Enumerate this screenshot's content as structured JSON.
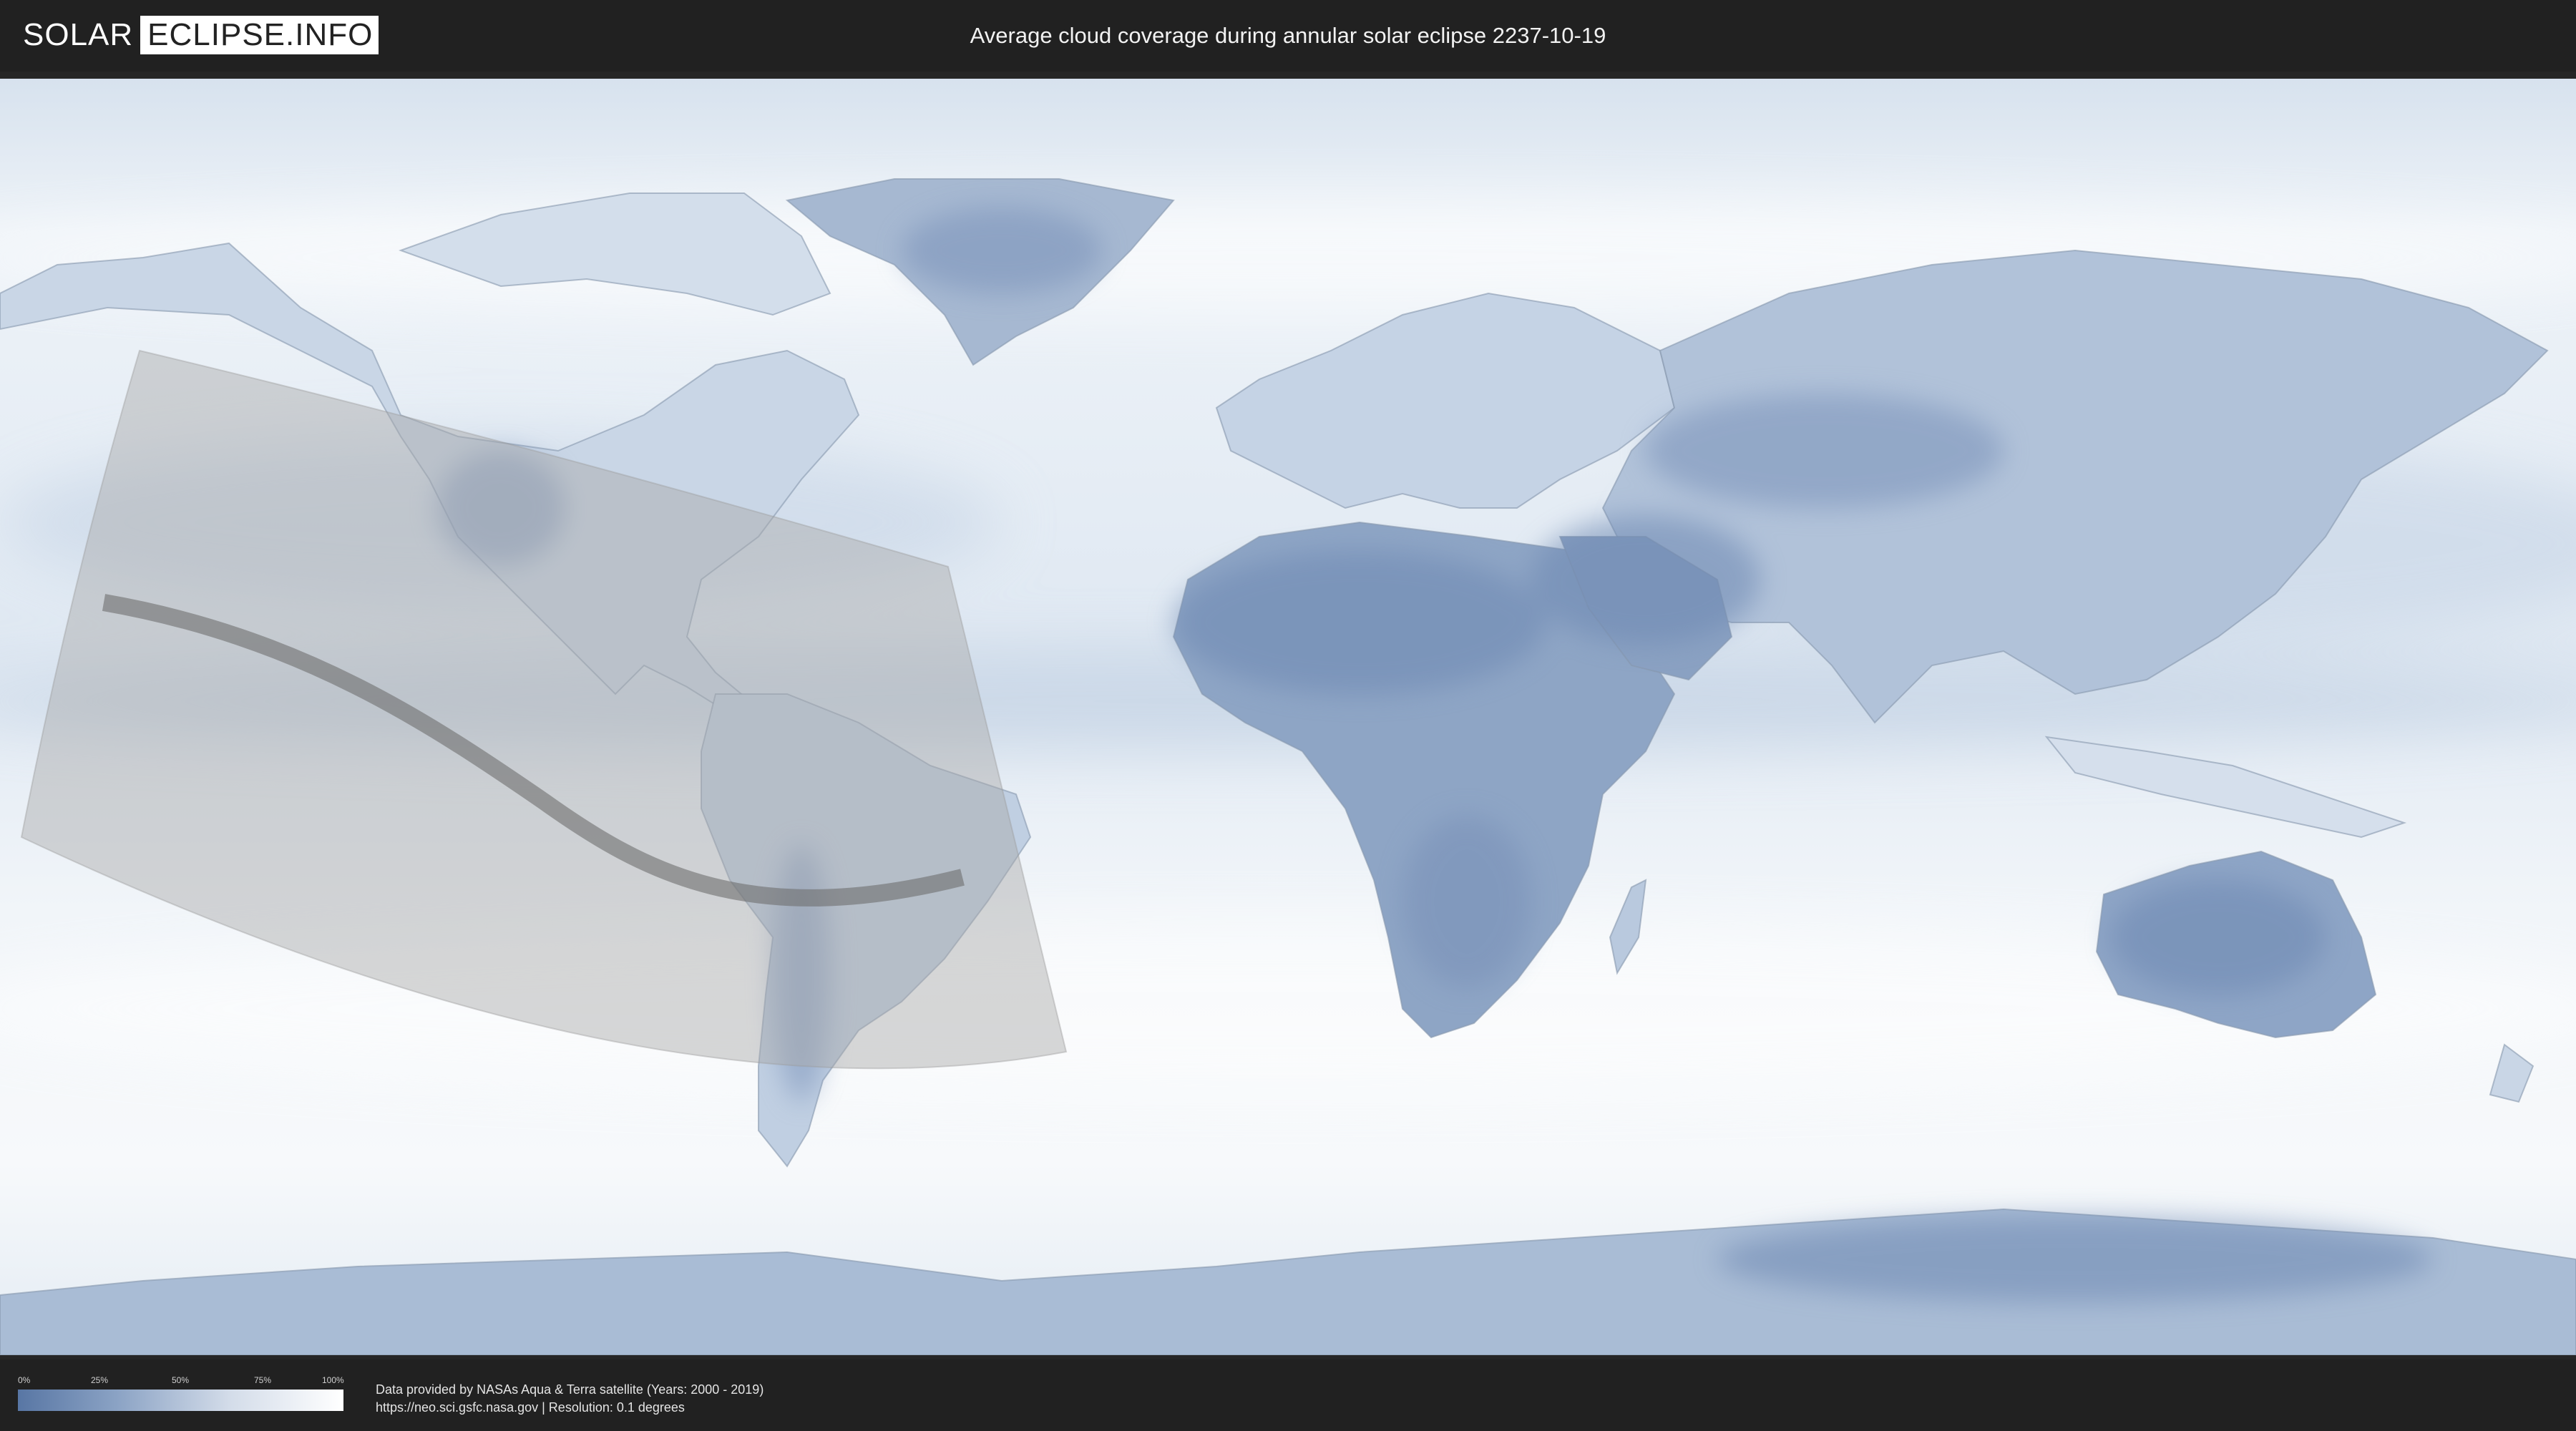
{
  "header": {
    "logo_part1": "SOLAR",
    "logo_part2": "ECLIPSE.INFO",
    "title": "Average cloud coverage during annular solar eclipse 2237-10-19"
  },
  "legend": {
    "ticks": [
      "0%",
      "25%",
      "50%",
      "75%",
      "100%"
    ],
    "colors": {
      "low": "#5876a4",
      "mid": "#b7c7dd",
      "high": "#ffffff"
    }
  },
  "footer": {
    "credit_line1": "Data provided by NASAs Aqua & Terra satellite (Years: 2000 - 2019)",
    "credit_line2": "https://neo.sci.gsfc.nasa.gov | Resolution: 0.1 degrees"
  },
  "map": {
    "colors": {
      "ocean_cloud": "#e6edf5",
      "clear_sky": "#6d88b2",
      "eclipse_zone": "#a8a8a8",
      "central_path": "#6e6e6e"
    }
  }
}
